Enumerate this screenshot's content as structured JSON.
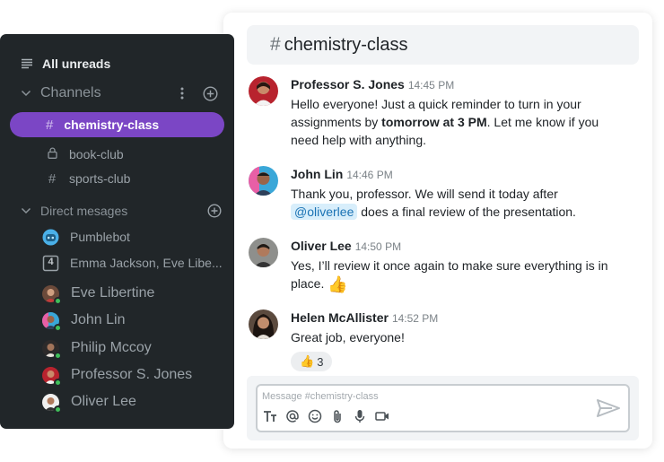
{
  "sidebar": {
    "all_unreads": "All unreads",
    "channels_title": "Channels",
    "channels": [
      {
        "name": "chemistry-class",
        "icon": "hash-icon",
        "active": true
      },
      {
        "name": "book-club",
        "icon": "lock-icon"
      },
      {
        "name": "sports-club",
        "icon": "hash-icon"
      }
    ],
    "dm_title": "Direct mesages",
    "dms": [
      {
        "name": "Pumblebot",
        "icon": "bot-icon"
      },
      {
        "name": "Emma Jackson, Eve Libe...",
        "icon": "group-count-icon",
        "count": "4"
      },
      {
        "name": "Eve Libertine",
        "online": true
      },
      {
        "name": "John Lin",
        "online": true
      },
      {
        "name": "Philip Mccoy",
        "online": true
      },
      {
        "name": "Professor S. Jones",
        "online": true
      },
      {
        "name": "Oliver Lee",
        "online": true
      }
    ]
  },
  "chat": {
    "channel_hash": "#",
    "channel_name": "chemistry-class",
    "messages": [
      {
        "author": "Professor S. Jones",
        "time": "14:45 PM",
        "text_before": "Hello everyone! Just a quick reminder to turn in your assignments by ",
        "text_bold": "tomorrow at 3 PM",
        "text_after": ". Let me know if you need help with anything."
      },
      {
        "author": "John Lin",
        "time": "14:46 PM",
        "text_before": "Thank you, professor. We will send it today after ",
        "mention": "@oliverlee",
        "text_after": " does a final review of the presentation."
      },
      {
        "author": "Oliver Lee",
        "time": "14:50 PM",
        "text_before": "Yes, I’ll review it once again to make sure everything is in place.",
        "emoji": "👍"
      },
      {
        "author": "Helen McAllister",
        "time": "14:52 PM",
        "text_before": "Great job, everyone!",
        "reaction_emoji": "👍",
        "reaction_count": "3"
      }
    ],
    "composer": {
      "placeholder": "Message #chemistry-class",
      "value": ""
    }
  },
  "colors": {
    "sidebar_bg": "#212629",
    "active_channel": "#7b46c5",
    "online": "#3fbf5a",
    "mention_bg": "#d8eefb"
  }
}
